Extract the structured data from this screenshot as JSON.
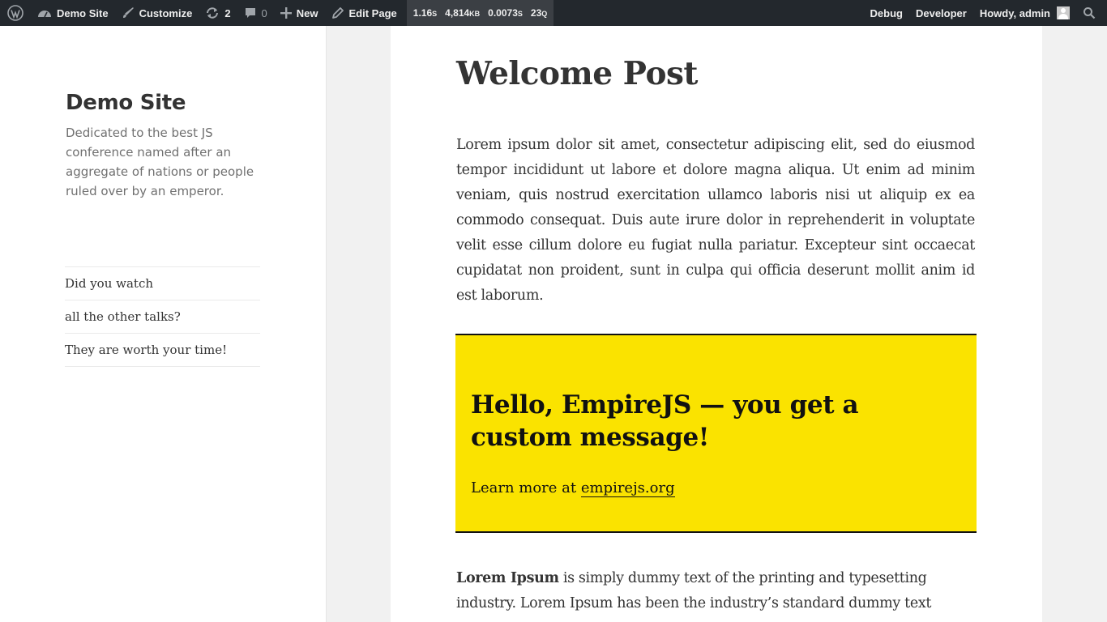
{
  "adminbar": {
    "site_name": "Demo Site",
    "customize": "Customize",
    "updates_count": "2",
    "comments_count": "0",
    "new_label": "New",
    "edit_page": "Edit Page",
    "qm": {
      "time": "1.16",
      "time_unit": "S",
      "memory": "4,814",
      "memory_unit": "KB",
      "db_time": "0.0073",
      "db_time_unit": "S",
      "queries": "23",
      "queries_unit": "Q"
    },
    "debug": "Debug",
    "developer": "Developer",
    "howdy": "Howdy, admin"
  },
  "sidebar": {
    "site_title": "Demo Site",
    "site_description": "Dedicated to the best JS conference named after an aggregate of nations or people ruled over by an emperor.",
    "menu": [
      {
        "label": "Did you watch"
      },
      {
        "label": "all the other talks?"
      },
      {
        "label": "They are worth your time!"
      }
    ]
  },
  "post": {
    "title": "Welcome Post",
    "paragraph1": "Lorem ipsum dolor sit amet, consectetur adipiscing elit, sed do eiusmod tempor incididunt ut labore et dolore magna aliqua. Ut enim ad minim veniam, quis nostrud exercitation ullamco laboris nisi ut aliquip ex ea commodo consequat. Duis aute irure dolor in reprehenderit in voluptate velit esse cillum dolore eu fugiat nulla pariatur. Excepteur sint occaecat cupidatat non proident, sunt in culpa qui officia deserunt mollit anim id est laborum.",
    "callout": {
      "heading": "Hello, EmpireJS — you get a custom message!",
      "text": "Learn more at ",
      "link_text": "empirejs.org",
      "background": "#fae300"
    },
    "paragraph2_bold": "Lorem Ipsum",
    "paragraph2_rest": " is simply dummy text of the printing and typesetting industry. Lorem Ipsum has been the industry’s standard dummy text"
  }
}
